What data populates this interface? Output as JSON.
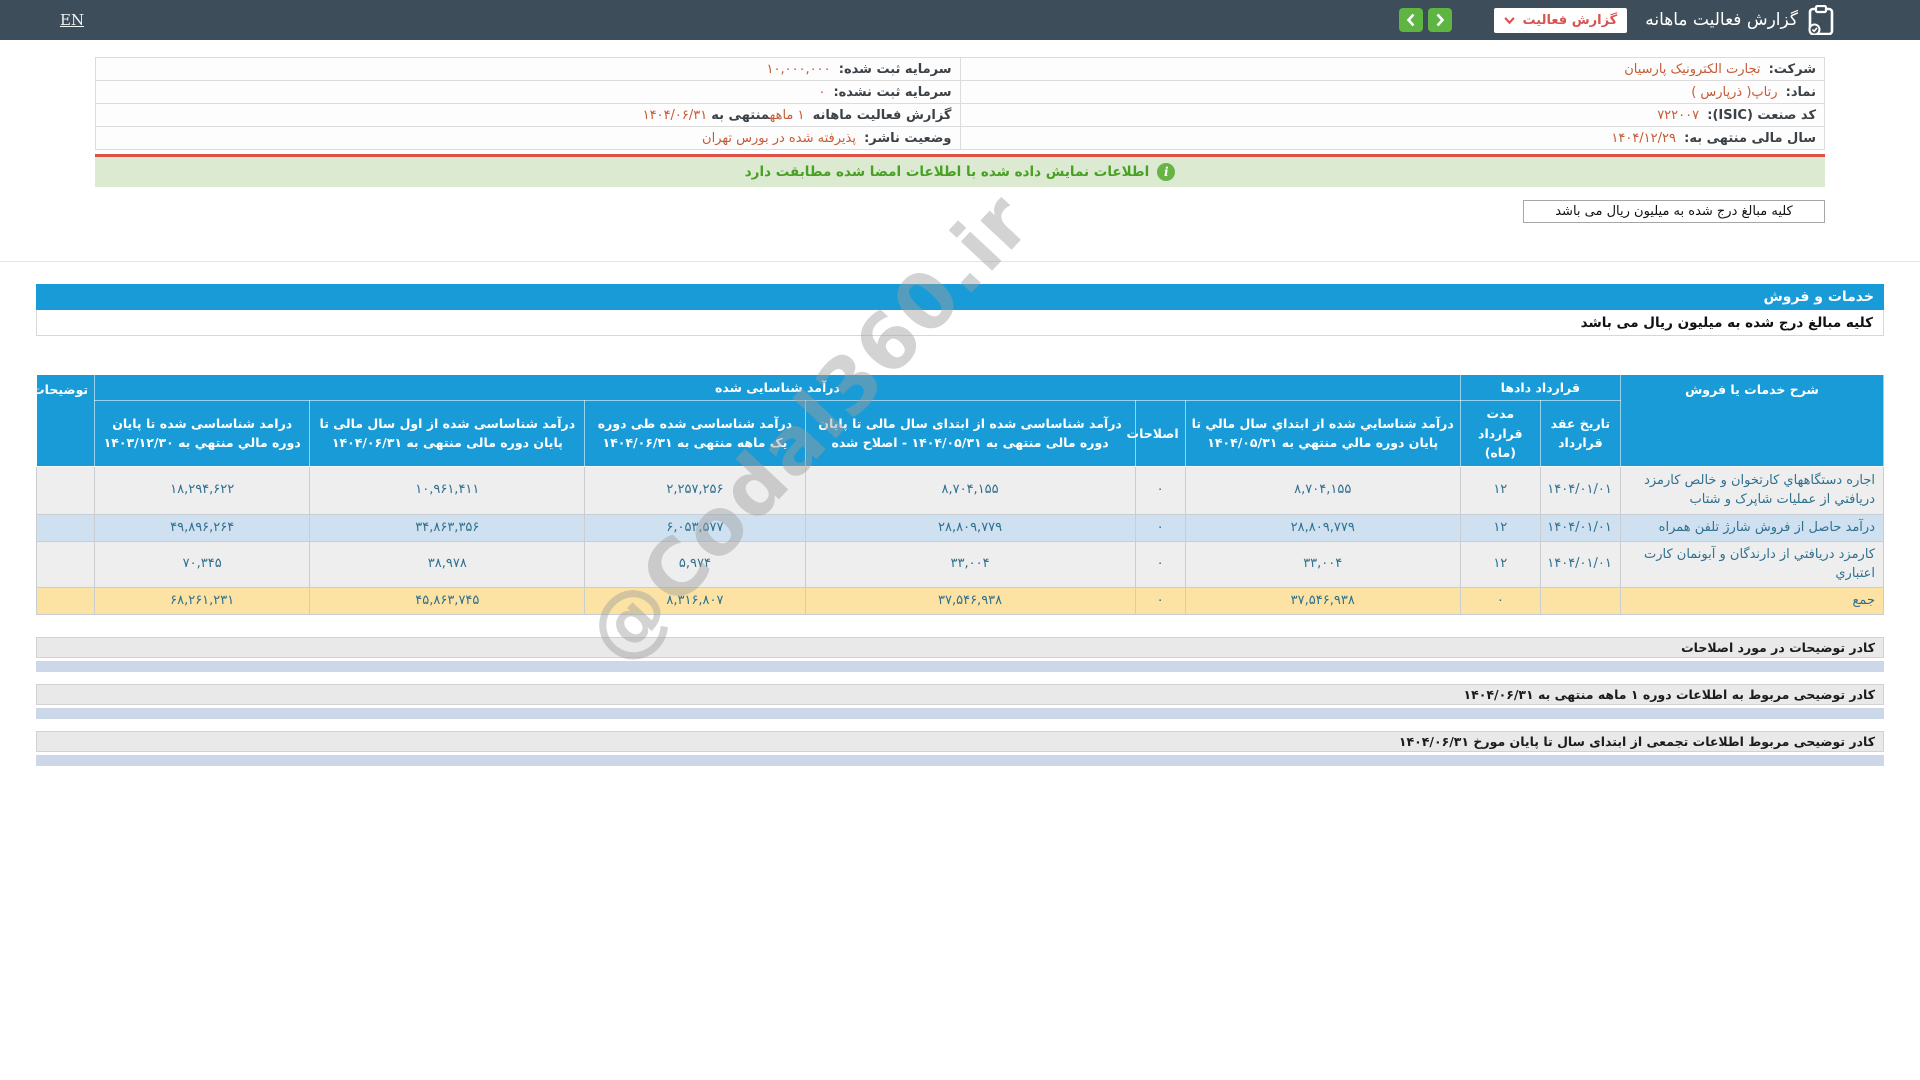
{
  "topbar": {
    "title": "گزارش فعالیت ماهانه",
    "report_button_label": "گزارش فعالیت",
    "lang_link": "EN"
  },
  "company_info": {
    "company_label": "شرکت:",
    "company_value": "تجارت الکترونیک پارسیان",
    "symbol_label": "نماد:",
    "symbol_value": "رتاپ( ذرپارس )",
    "isic_label": "کد صنعت (ISIC):",
    "isic_value": "۷۲۲۰۰۷",
    "fiscal_label": "سال مالی منتهی به:",
    "fiscal_value": "۱۴۰۴/۱۲/۲۹",
    "registered_capital_label": "سرمایه ثبت شده:",
    "registered_capital_value": "۱۰,۰۰۰,۰۰۰",
    "unregistered_capital_label": "سرمایه ثبت نشده:",
    "unregistered_capital_value": "۰",
    "report_period_prefix": "گزارش فعالیت ماهانه",
    "report_period_highlight": "۱ ماهه",
    "report_period_mid": "منتهی به",
    "report_period_date": "۱۴۰۴/۰۶/۳۱",
    "status_label": "وضعیت ناشر:",
    "status_value": "پذیرفته شده در بورس تهران"
  },
  "signature_bar": "اطلاعات نمایش داده شده با اطلاعات امضا شده مطابقت دارد",
  "amounts_note": "کلیه مبالغ درج شده به میلیون ریال می باشد",
  "section": {
    "title": "خدمات و فروش",
    "note": "کلیه مبالغ درج شده به میلیون ریال می باشد"
  },
  "table": {
    "groups": {
      "desc": "شرح خدمات یا فروش",
      "contract": "قرارداد دادها",
      "revenue": "درآمد شناسایی شده",
      "notes": "توضیحات"
    },
    "sub_headers": [
      "تاریخ عقد قرارداد",
      "مدت قرارداد (ماه)",
      "درآمد شناسايي شده از ابتداي سال مالي تا پايان دوره مالي منتهي به ۱۴۰۴/۰۵/۳۱",
      "اصلاحات",
      "درآمد شناساسی شده از ابتدای سال مالی تا پایان دوره مالی منتهی به ۱۴۰۴/۰۵/۳۱ - اصلاح شده",
      "درآمد شناساسی شده طی دوره یک ماهه منتهی به ۱۴۰۴/۰۶/۳۱",
      "درآمد شناساسی شده از اول سال مالی تا پایان دوره مالی منتهی به ۱۴۰۴/۰۶/۳۱",
      "درامد شناساسی شده تا پایان دوره مالي منتهي به ۱۴۰۳/۱۲/۳۰"
    ],
    "rows": [
      {
        "desc": "اجاره دستگاههاي کارتخوان و خالص کارمزد دریافتي از عملیات شاپرک و شتاب",
        "contract_date": "۱۴۰۴/۰۱/۰۱",
        "duration": "۱۲",
        "rev_to_0531": "۸,۷۰۴,۱۵۵",
        "adjustments": "۰",
        "rev_to_0531_adjusted": "۸,۷۰۴,۱۵۵",
        "rev_month": "۲,۲۵۷,۲۵۶",
        "rev_ytd_0631": "۱۰,۹۶۱,۴۱۱",
        "rev_prev_year": "۱۸,۲۹۴,۶۲۲",
        "notes": ""
      },
      {
        "desc": "درآمد حاصل از فروش شارژ تلفن همراه",
        "contract_date": "۱۴۰۴/۰۱/۰۱",
        "duration": "۱۲",
        "rev_to_0531": "۲۸,۸۰۹,۷۷۹",
        "adjustments": "۰",
        "rev_to_0531_adjusted": "۲۸,۸۰۹,۷۷۹",
        "rev_month": "۶,۰۵۳,۵۷۷",
        "rev_ytd_0631": "۳۴,۸۶۳,۳۵۶",
        "rev_prev_year": "۴۹,۸۹۶,۲۶۴",
        "notes": ""
      },
      {
        "desc": "کارمزد دریافتي از دارندگان و آبونمان کارت اعتباري",
        "contract_date": "۱۴۰۴/۰۱/۰۱",
        "duration": "۱۲",
        "rev_to_0531": "۳۳,۰۰۴",
        "adjustments": "۰",
        "rev_to_0531_adjusted": "۳۳,۰۰۴",
        "rev_month": "۵,۹۷۴",
        "rev_ytd_0631": "۳۸,۹۷۸",
        "rev_prev_year": "۷۰,۳۴۵",
        "notes": ""
      },
      {
        "desc": "جمع",
        "contract_date": "",
        "duration": "۰",
        "rev_to_0531": "۳۷,۵۴۶,۹۳۸",
        "adjustments": "۰",
        "rev_to_0531_adjusted": "۳۷,۵۴۶,۹۳۸",
        "rev_month": "۸,۳۱۶,۸۰۷",
        "rev_ytd_0631": "۴۵,۸۶۳,۷۴۵",
        "rev_prev_year": "۶۸,۲۶۱,۲۳۱",
        "notes": ""
      }
    ]
  },
  "footers": [
    "کادر توضیحات در مورد اصلاحات",
    "کادر توضیحی مربوط به اطلاعات دوره ۱ ماهه منتهی به ۱۴۰۴/۰۶/۳۱",
    "کادر توضیحی مربوط اطلاعات تجمعی از ابتدای سال تا پایان مورخ ۱۴۰۴/۰۶/۳۱"
  ],
  "watermark": "@Codal360.ir",
  "colors": {
    "topbar": "#3d4e5a",
    "accent_blue": "#189bd7",
    "accent_red": "#d9534f",
    "accent_green": "#5fb542",
    "value_orange": "#c65b35",
    "cell_text": "#30708f",
    "row_sum": "#fce3a3",
    "row_alt": "#cfe1f1"
  }
}
